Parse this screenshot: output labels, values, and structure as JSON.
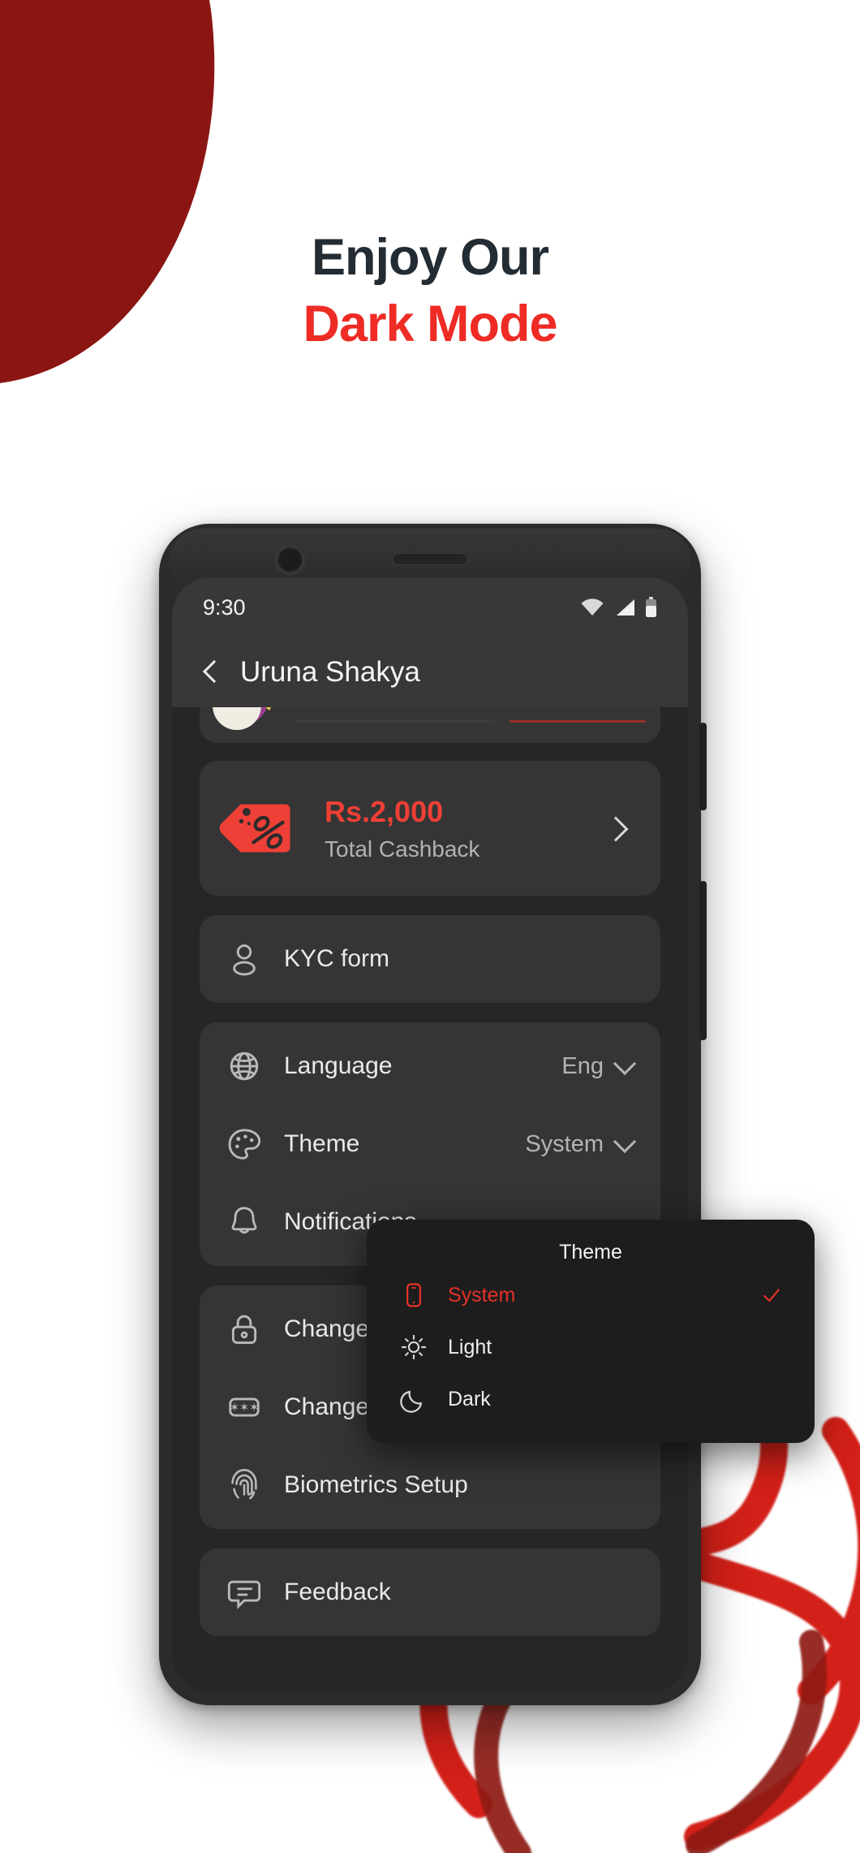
{
  "promo": {
    "headline_line1": "Enjoy Our",
    "headline_line2": "Dark Mode",
    "accent_color": "#EE2B24",
    "headline_color": "#232b33",
    "blob_color": "#8B1512"
  },
  "phone": {
    "statusbar": {
      "time": "9:30",
      "icons": [
        "wifi-icon",
        "cellular-signal-icon",
        "battery-icon"
      ]
    },
    "appbar": {
      "back_icon": "chevron-left-icon",
      "title": "Uruna Shakya"
    },
    "cashback_card": {
      "icon": "discount-tag-icon",
      "amount": "Rs.2,000",
      "label": "Total Cashback",
      "chevron": "chevron-right-icon",
      "amount_color": "#EE4036"
    },
    "kyc_row": {
      "icon": "person-icon",
      "label": "KYC form"
    },
    "preferences": [
      {
        "icon": "globe-icon",
        "label": "Language",
        "value": "Eng",
        "chevron": "chevron-down-icon"
      },
      {
        "icon": "palette-icon",
        "label": "Theme",
        "value": "System",
        "chevron": "chevron-down-icon"
      },
      {
        "icon": "bell-icon",
        "label": "Notifications",
        "value": "",
        "chevron": ""
      }
    ],
    "security": [
      {
        "icon": "lock-icon",
        "label": "Change Password"
      },
      {
        "icon": "pin-dots-icon",
        "label": "Change PIN"
      },
      {
        "icon": "fingerprint-icon",
        "label": "Biometrics Setup"
      }
    ],
    "feedback_row": {
      "icon": "chat-feedback-icon",
      "label": "Feedback"
    }
  },
  "theme_dialog": {
    "title": "Theme",
    "selected": "System",
    "selected_color": "#E53228",
    "check_icon": "check-icon",
    "options": [
      {
        "icon": "phone-outline-icon",
        "label": "System",
        "selected": true
      },
      {
        "icon": "sun-icon",
        "label": "Light",
        "selected": false
      },
      {
        "icon": "moon-icon",
        "label": "Dark",
        "selected": false
      }
    ]
  }
}
